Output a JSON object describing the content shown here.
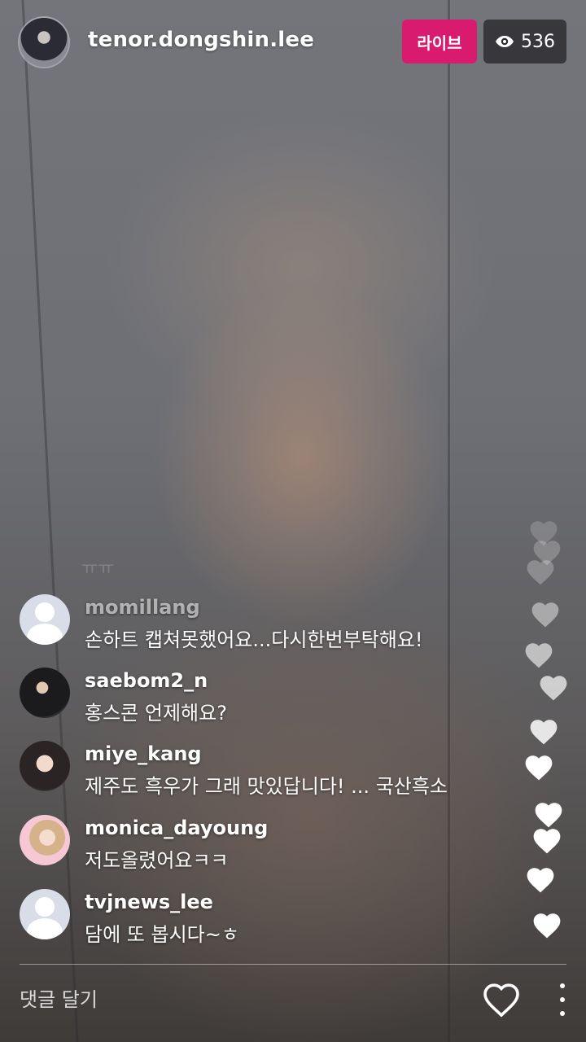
{
  "header": {
    "username": "tenor.dongshin.lee",
    "live_label": "라이브",
    "viewer_count": "536",
    "live_color": "#d81b6f"
  },
  "comments": [
    {
      "username": "momillang",
      "text": "손하트 캡쳐못했어요...다시한번부탁해요!",
      "avatar": "default-avatar"
    },
    {
      "username": "saebom2_n",
      "text": "홍스콘 언제해요?",
      "avatar": "photo-avatar"
    },
    {
      "username": "miye_kang",
      "text": "제주도 흑우가 그래 맛있답니다! ... 국산흑소",
      "avatar": "photo-avatar"
    },
    {
      "username": "monica_dayoung",
      "text": "저도올렸어요ㅋㅋ",
      "avatar": "photo-avatar"
    },
    {
      "username": "tvjnews_lee",
      "text": "담에 또 봅시다~ㅎ",
      "avatar": "default-avatar"
    }
  ],
  "footer": {
    "comment_placeholder": "댓글 달기",
    "like_icon": "heart-outline-icon",
    "more_icon": "vertical-dots-icon"
  }
}
